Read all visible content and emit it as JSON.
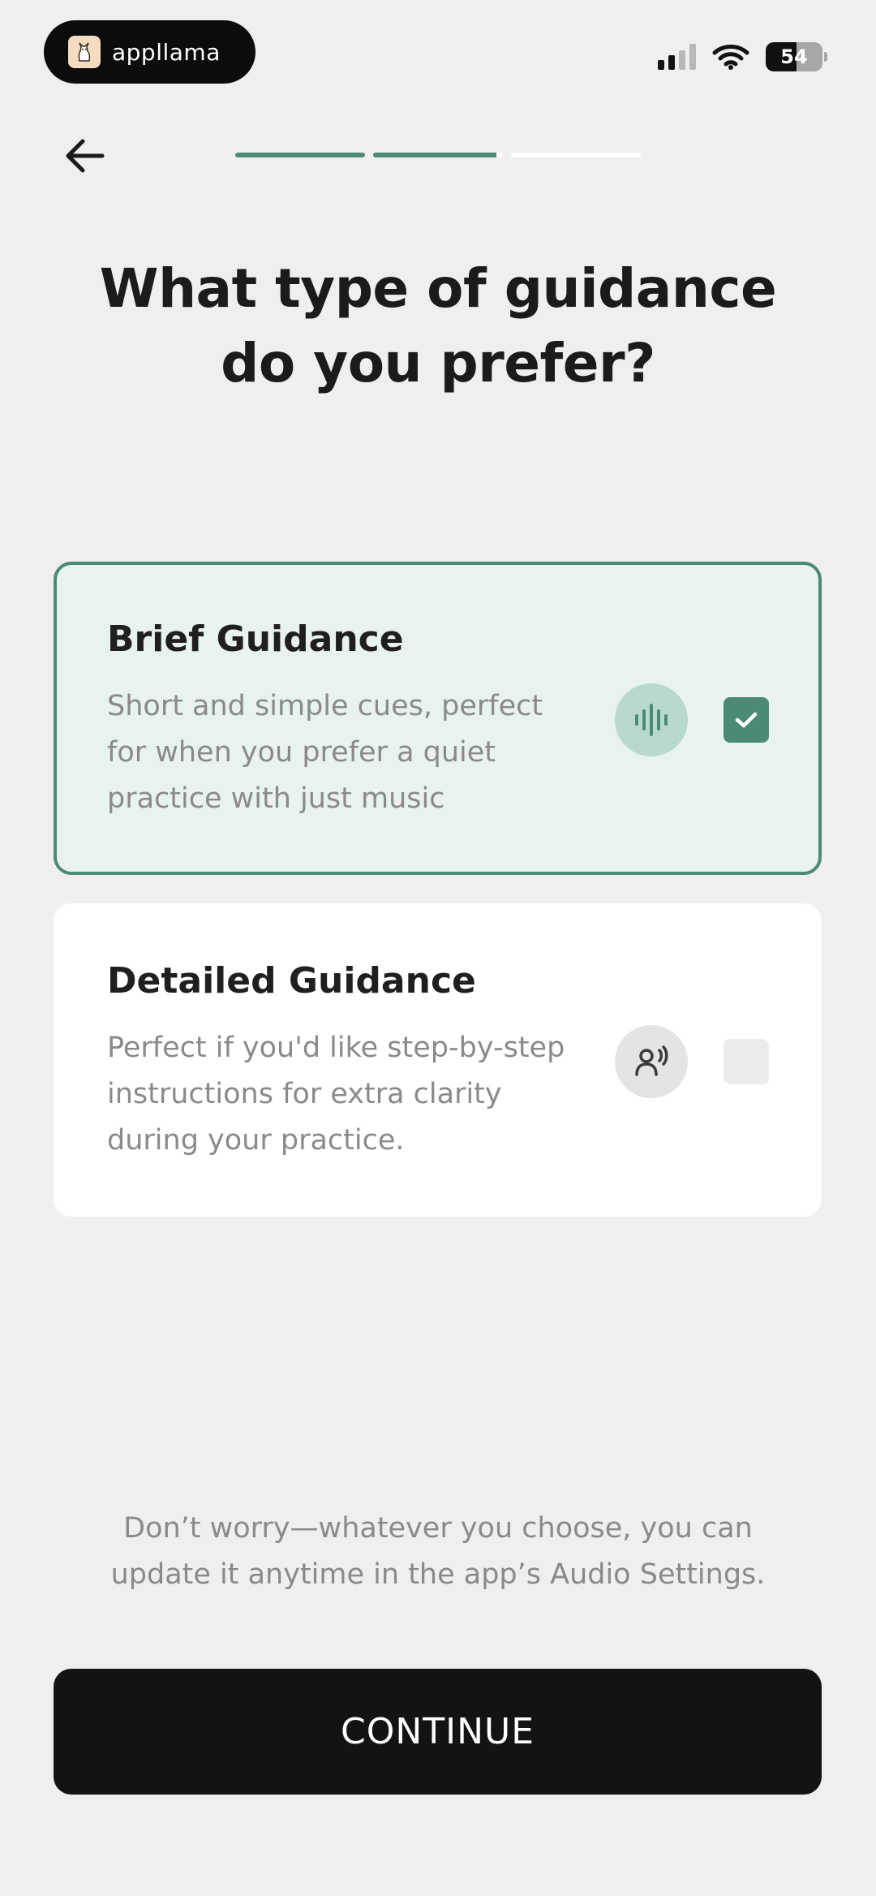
{
  "status_bar": {
    "app_name": "appllama",
    "battery_level": "54",
    "battery_fraction": 0.54,
    "signal_bars_active": 2,
    "signal_bars_total": 4,
    "icons": [
      "llama-logo-icon",
      "cellular-signal-icon",
      "wifi-icon",
      "battery-icon"
    ]
  },
  "header": {
    "back_icon": "arrow-left-icon",
    "progress_segments": [
      1.0,
      0.95,
      0.0
    ]
  },
  "page_title": "What type of guidance do you prefer?",
  "options": [
    {
      "title": "Brief Guidance",
      "description": "Short and simple cues, perfect for when you prefer a quiet practice with just music",
      "icon": "sound-wave-icon",
      "selected": true
    },
    {
      "title": "Detailed Guidance",
      "description": "Perfect if you'd like step-by-step instructions for extra clarity during your practice.",
      "icon": "person-speaking-icon",
      "selected": false
    }
  ],
  "footer_note": "Don’t worry—whatever you choose, you can update it anytime in the app’s Audio Settings.",
  "continue_label": "CONTINUE",
  "colors": {
    "accent": "#4a8a76",
    "selected_background": "#e8f2ef",
    "page_background": "#f0eeef",
    "button_background": "#141213"
  }
}
